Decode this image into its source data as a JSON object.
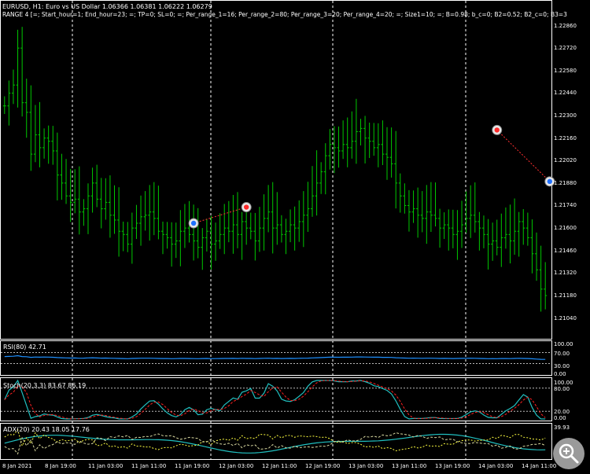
{
  "header": {
    "line1": "EURUSD, H1:  Euro vs US Dollar  1.06366 1.06381 1.06222 1.06279",
    "line2": "RANGE 4 [=; Start_hour=1; End_hour=23; =; TP=0; SL=0; =; Per_range_1=16; Per_range_2=80; Per_range_3=20; Per_range_4=20; =; Size1=10; =; B=0.98; b_c=0; B2=0.52; B2_c=0; B3=3"
  },
  "price_axis": [
    "1.22860",
    "1.22720",
    "1.22580",
    "1.22440",
    "1.22300",
    "1.22160",
    "1.22020",
    "1.21880",
    "1.21740",
    "1.21600",
    "1.21460",
    "1.21320",
    "1.21180",
    "1.21040"
  ],
  "time_axis": [
    "8 Jan 2021",
    "8 Jan 19:00",
    "11 Jan 03:00",
    "11 Jan 11:00",
    "11 Jan 19:00",
    "12 Jan 03:00",
    "12 Jan 11:00",
    "12 Jan 19:00",
    "13 Jan 03:00",
    "13 Jan 11:00",
    "13 Jan 19:00",
    "14 Jan 03:00",
    "14 Jan 11:00"
  ],
  "indicators": {
    "rsi": {
      "label": "RSI(80) 42.71",
      "axis": [
        "100.00",
        "70.00",
        "30.00",
        "0.00"
      ]
    },
    "stoch": {
      "label": "Stoch(20,3,3) 83.67 86.19",
      "axis": [
        "100.00",
        "80.00",
        "20.00",
        "0.00"
      ]
    },
    "adx": {
      "label": "ADX(20) 20.43 18.05 17.76",
      "axis": [
        "39.93"
      ]
    }
  },
  "colors": {
    "background": "#000000",
    "bar": "#00c800",
    "rsi": "#1e90ff",
    "stoch_main": "#20c0c0",
    "stoch_signal": "#ff2020",
    "adx": "#20c0c0",
    "adx_plus": "#ffff40",
    "adx_minus": "#d8d8a0",
    "grid": "#ffffff"
  },
  "chart_data": {
    "type": "ohlc",
    "symbol": "EURUSD",
    "timeframe": "H1",
    "ylim": [
      1.2095,
      1.2298
    ],
    "closes": [
      1.2236,
      1.2244,
      1.2249,
      1.2272,
      1.2238,
      1.2232,
      1.2206,
      1.2218,
      1.221,
      1.2216,
      1.2214,
      1.2208,
      1.2193,
      1.2188,
      1.218,
      1.2176,
      1.2178,
      1.217,
      1.2172,
      1.218,
      1.2188,
      1.2178,
      1.2172,
      1.2176,
      1.2168,
      1.2165,
      1.2158,
      1.2156,
      1.215,
      1.216,
      1.2163,
      1.2167,
      1.2168,
      1.217,
      1.2166,
      1.2158,
      1.2156,
      1.2154,
      1.215,
      1.2152,
      1.2158,
      1.216,
      1.2156,
      1.2152,
      1.2148,
      1.2154,
      1.2158,
      1.215,
      1.2152,
      1.2156,
      1.216,
      1.2158,
      1.2162,
      1.2156,
      1.2164,
      1.216,
      1.2158,
      1.2152,
      1.216,
      1.2166,
      1.217,
      1.216,
      1.2162,
      1.2156,
      1.2158,
      1.2162,
      1.216,
      1.2164,
      1.2168,
      1.2172,
      1.218,
      1.2188,
      1.2195,
      1.2205,
      1.2212,
      1.221,
      1.2208,
      1.2212,
      1.221,
      1.2214,
      1.222,
      1.2222,
      1.2216,
      1.2214,
      1.221,
      1.2212,
      1.2206,
      1.2204,
      1.22,
      1.2188,
      1.218,
      1.2174,
      1.217,
      1.2172,
      1.2168,
      1.2166,
      1.217,
      1.2168,
      1.2166,
      1.216,
      1.2162,
      1.216,
      1.2156,
      1.2158,
      1.2162,
      1.2166,
      1.2168,
      1.2164,
      1.216,
      1.2156,
      1.215,
      1.2152,
      1.2148,
      1.2154,
      1.2156,
      1.2152,
      1.2158,
      1.2164,
      1.216,
      1.2154,
      1.2144,
      1.2134,
      1.2122,
      1.2118
    ],
    "arrows": [
      {
        "type": "buy",
        "bar": 43,
        "price": 1.2163
      },
      {
        "type": "sell",
        "bar": 55,
        "price": 1.2173
      },
      {
        "type": "sell",
        "bar": 112,
        "price": 1.2221
      },
      {
        "type": "buy",
        "bar": 124,
        "price": 1.2189
      }
    ],
    "rsi_ylim": [
      0,
      100
    ],
    "rsi_levels": [
      70,
      30
    ],
    "stoch_levels": [
      80,
      20
    ],
    "stoch_ylim": [
      0,
      100
    ],
    "adx_ylim": [
      0,
      39.93
    ],
    "rsi": {
      "label": "RSI(80)",
      "value": 42.71
    },
    "stoch": {
      "label": "Stoch(20,3,3)",
      "main": 83.67,
      "signal": 86.19
    },
    "adx": {
      "label": "ADX(20)",
      "adx": 20.43,
      "plus_di": 18.05,
      "minus_di": 17.76
    }
  }
}
